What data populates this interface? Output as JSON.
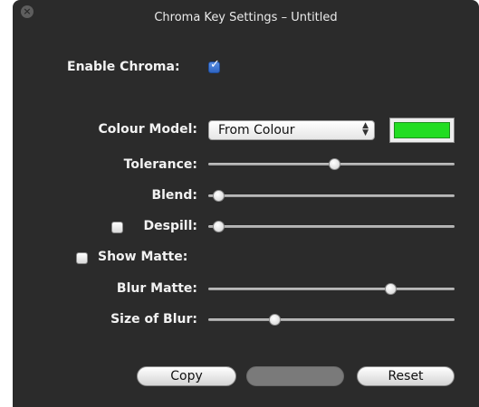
{
  "window": {
    "title": "Chroma Key Settings – Untitled",
    "close_icon": "close-icon"
  },
  "enable_chroma": {
    "label": "Enable Chroma:",
    "checked": true
  },
  "colour_model": {
    "label": "Colour Model:",
    "value": "From Colour",
    "swatch_color": "#22dd22"
  },
  "sliders": {
    "tolerance": {
      "label": "Tolerance:",
      "value": 0.51
    },
    "blend": {
      "label": "Blend:",
      "value": 0.04
    },
    "despill": {
      "label": "Despill:",
      "value": 0.04,
      "checked": false
    },
    "blur_matte": {
      "label": "Blur Matte:",
      "value": 0.74
    },
    "size_of_blur": {
      "label": "Size of Blur:",
      "value": 0.27
    }
  },
  "show_matte": {
    "label": "Show Matte:",
    "checked": false
  },
  "buttons": {
    "copy": "Copy",
    "paste": "",
    "reset": "Reset"
  }
}
